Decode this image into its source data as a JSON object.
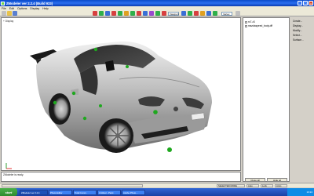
{
  "window": {
    "title": "ZModeler ver 2.2.4 (Build 933)",
    "controls": [
      "_",
      "□",
      "×"
    ]
  },
  "menu": {
    "items": [
      "File",
      "Edit",
      "Options",
      "Display",
      "Help"
    ]
  },
  "toolbar": {
    "view_select": "Viewport",
    "mode_select": "Vertex"
  },
  "viewport": {
    "label": "+ Display"
  },
  "scene_tree": {
    "items": [
      {
        "label": "rx7.z3"
      },
      {
        "label": "mazdaspeed_body.dff"
      }
    ]
  },
  "side_menu": {
    "items": [
      "Create...",
      "Display...",
      "Modify...",
      "Select...",
      "Surface..."
    ]
  },
  "panel_buttons": {
    "left": "Close all",
    "right": "Hide all"
  },
  "console": {
    "text": "ZModeler is ready."
  },
  "status_bar": {
    "mode": "SELECTED MODE",
    "values": [
      "Auto",
      "Lock",
      "Anim"
    ]
  },
  "taskbar": {
    "start": "start",
    "tasks": [
      "ZModeler ver 2.2.4",
      "Photo Editor",
      "Total Comm.",
      "Untitled - Paint",
      "Adobe Photo..."
    ],
    "clock": "10:24"
  },
  "colors": {
    "title_bar": "#0a4ac9",
    "taskbar": "#245edb",
    "start_button": "#3a9e3a",
    "selection_markers": "#1fa81f"
  }
}
